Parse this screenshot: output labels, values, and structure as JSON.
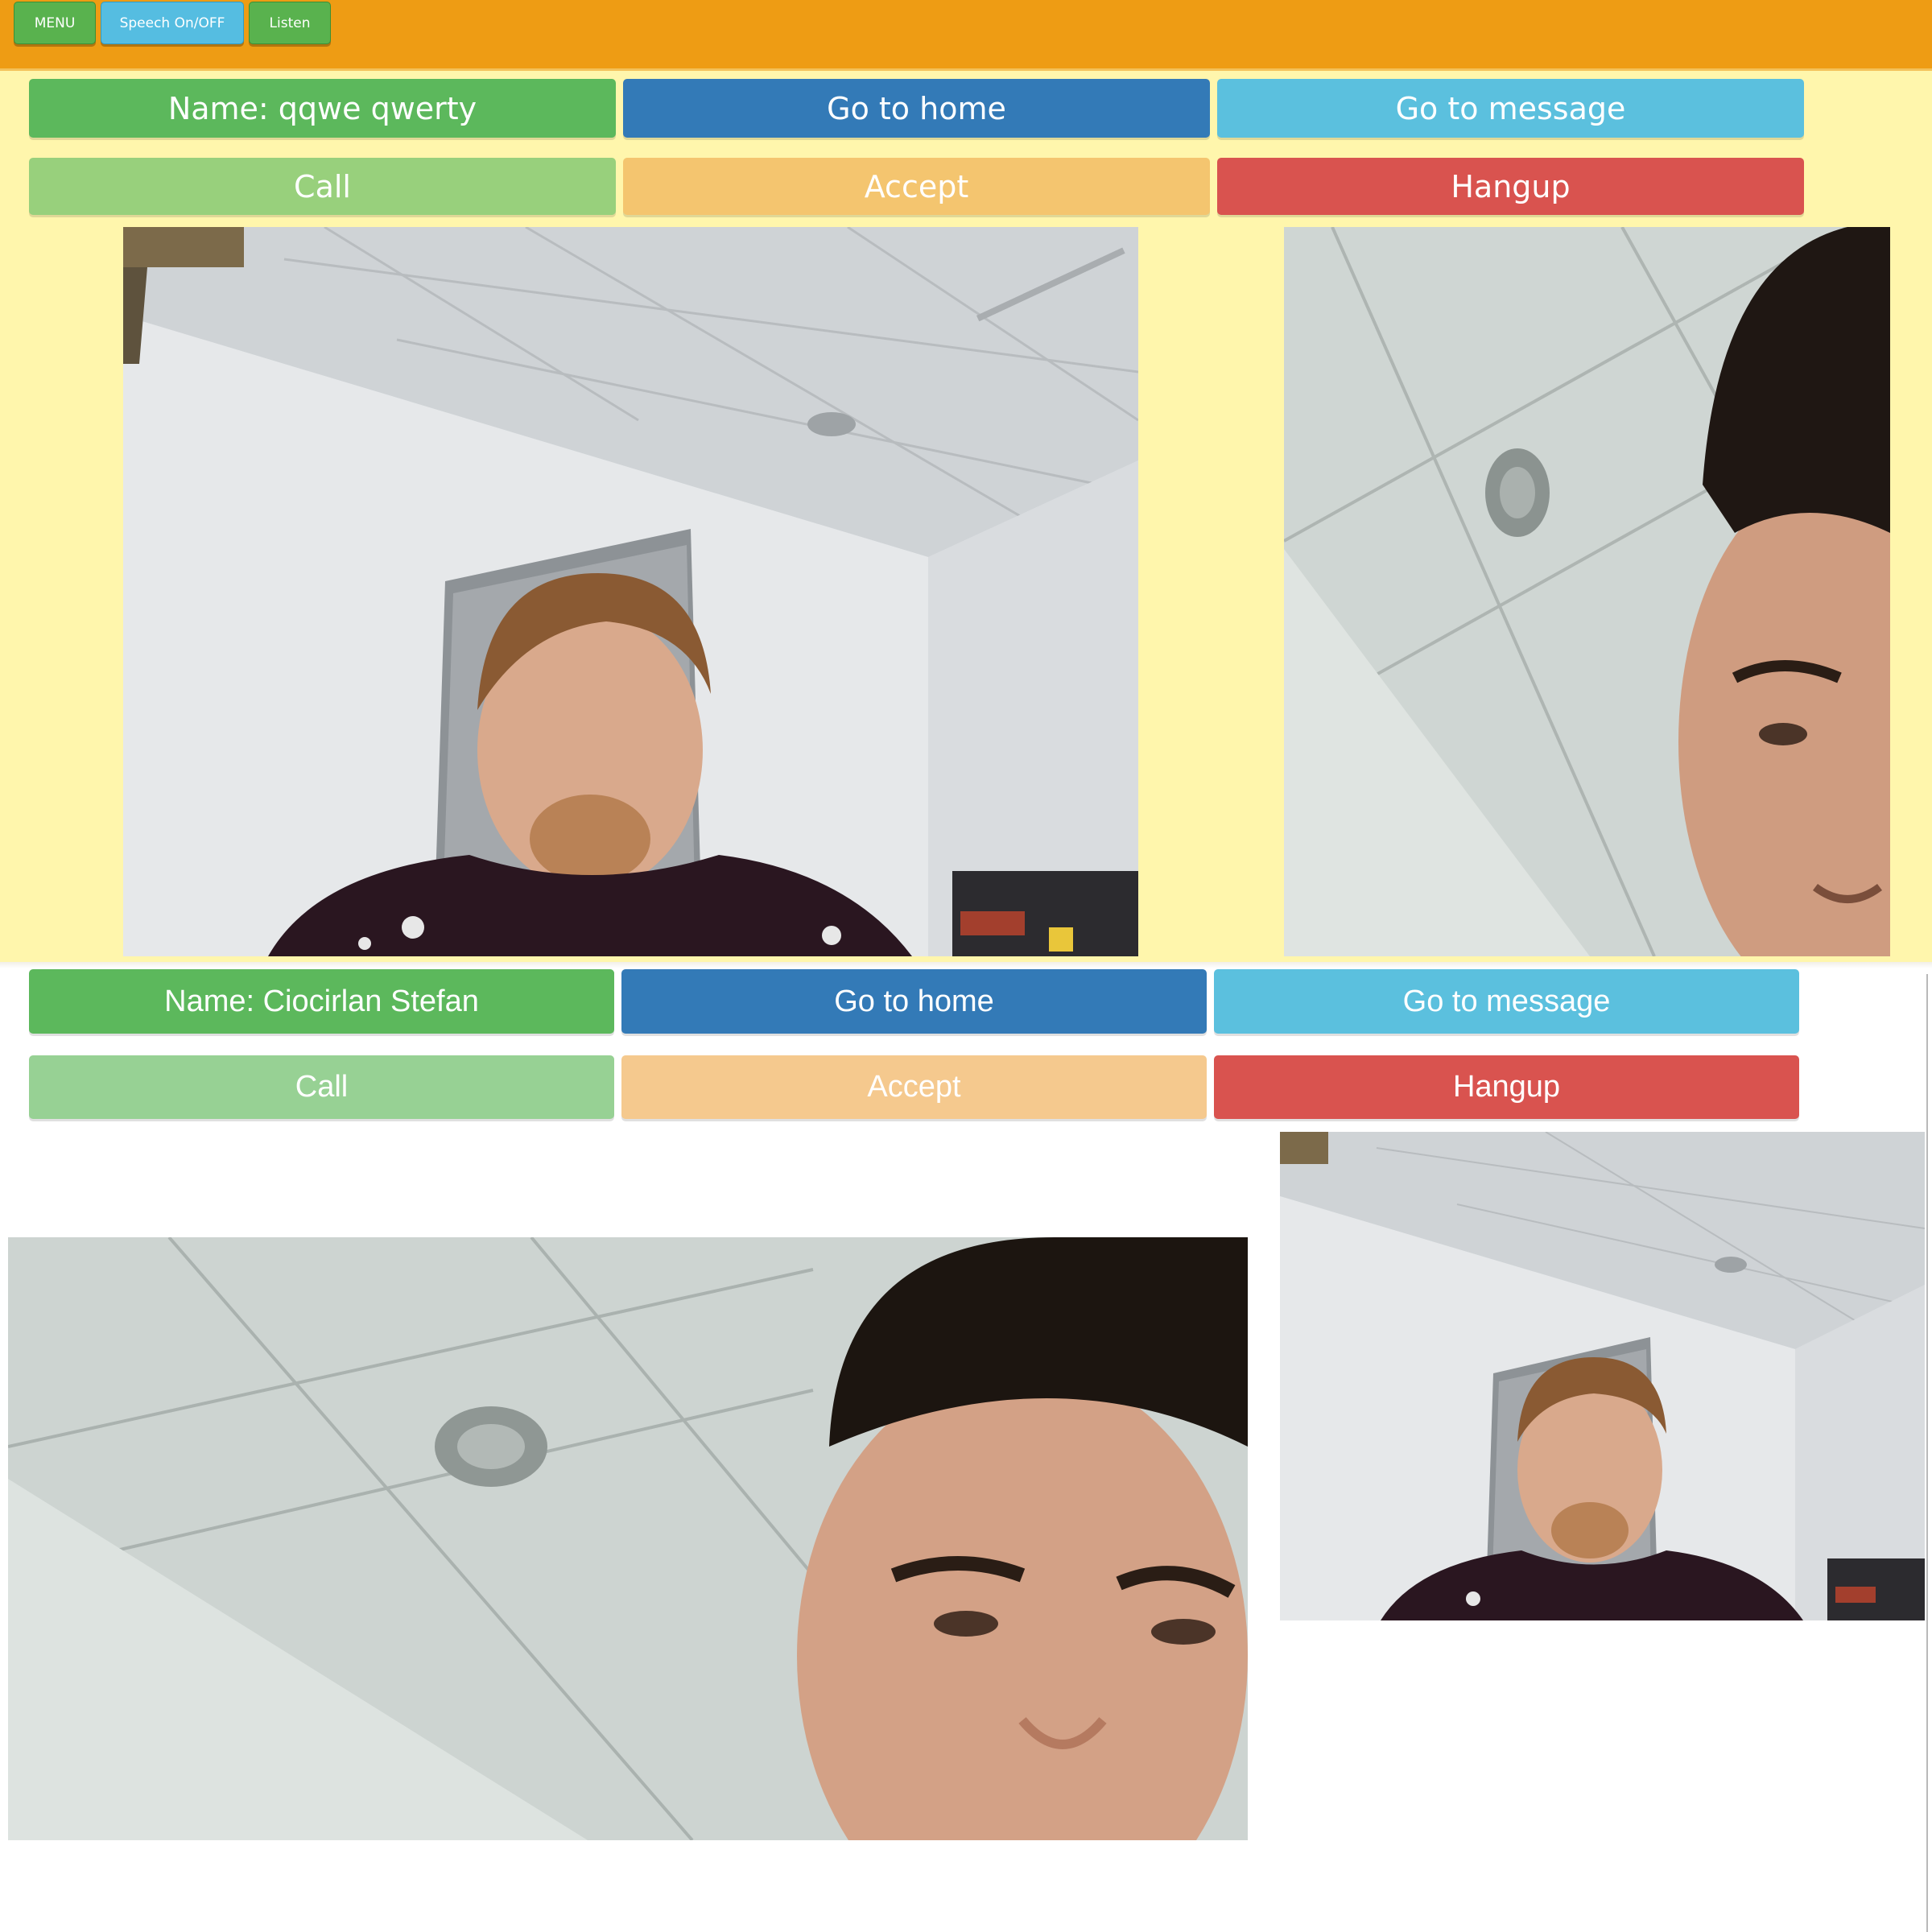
{
  "toolbar": {
    "menu_label": "MENU",
    "speech_label": "Speech On/OFF",
    "listen_label": "Listen",
    "color": "#ee9c14"
  },
  "session_top": {
    "background": "#fff6ac",
    "name_label": "Name: qqwe qwerty",
    "home_label": "Go to home",
    "message_label": "Go to message",
    "call_label": "Call",
    "accept_label": "Accept",
    "hangup_label": "Hangup"
  },
  "session_bottom": {
    "background": "#ffffff",
    "name_label": "Name: Ciocirlan Stefan",
    "home_label": "Go to home",
    "message_label": "Go to message",
    "call_label": "Call",
    "accept_label": "Accept",
    "hangup_label": "Hangup"
  },
  "colors": {
    "success": "#5cb85c",
    "primary": "#337ab7",
    "info": "#5bc0de",
    "warning": "#f0ad4e",
    "danger": "#d9534f"
  }
}
